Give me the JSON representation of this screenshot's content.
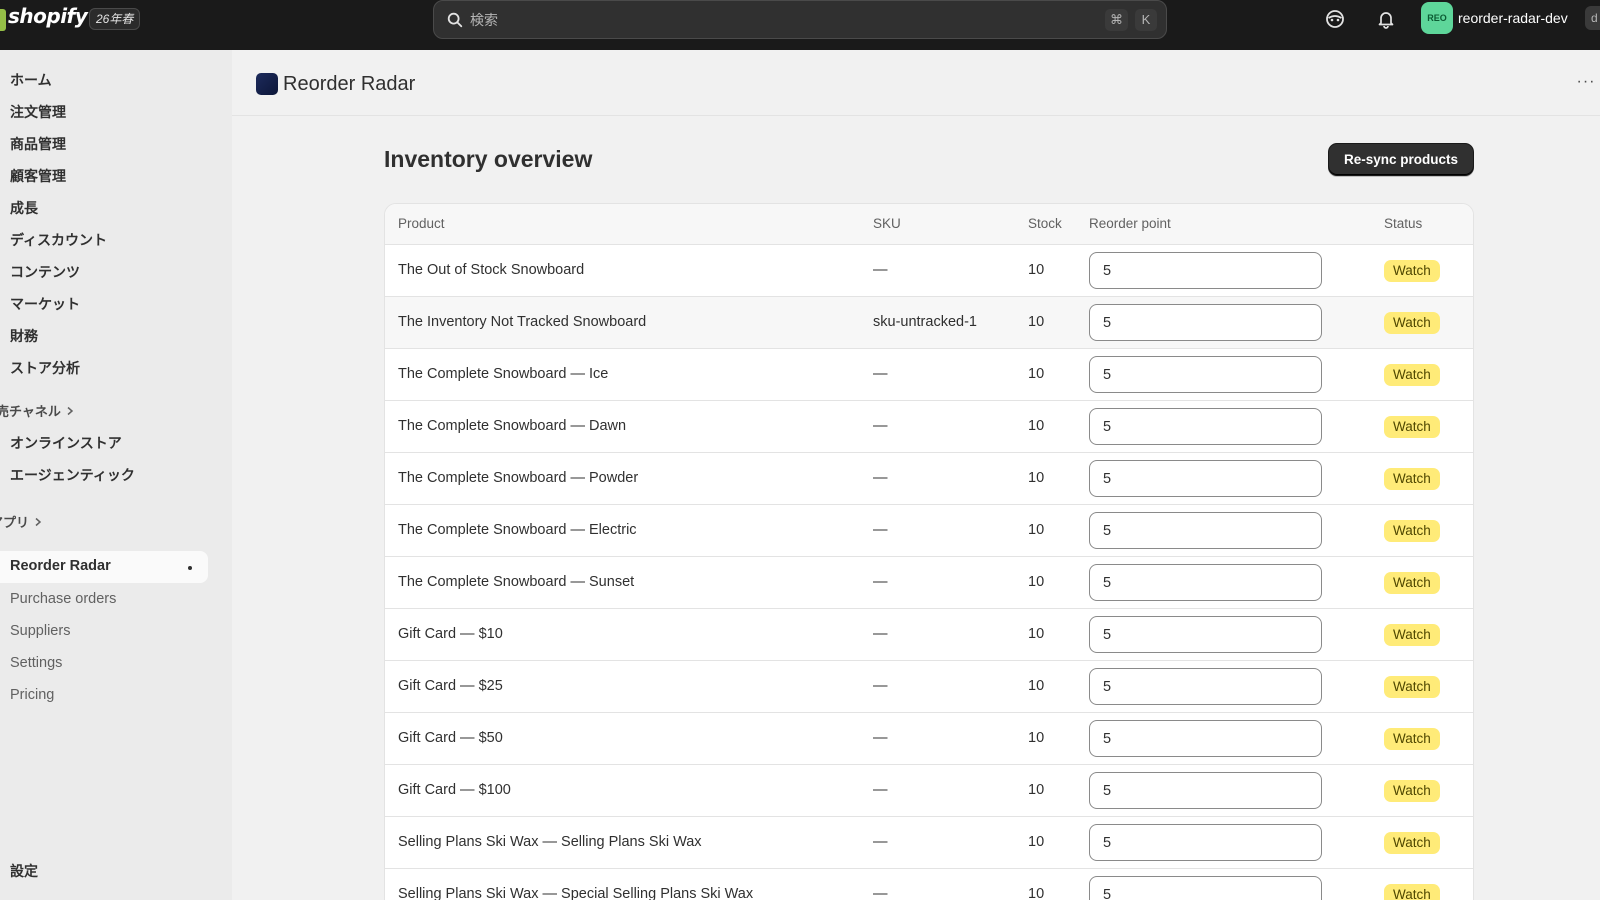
{
  "topbar": {
    "logo_text": "shopify",
    "edition_badge": "26年春",
    "search_placeholder": "検索",
    "shortcut_cmd": "⌘",
    "shortcut_key": "K",
    "store_avatar": "REO",
    "store_name": "reorder-radar-dev",
    "store_suffix": "d"
  },
  "sidebar": {
    "main_items": [
      "ホーム",
      "注文管理",
      "商品管理",
      "顧客管理",
      "成長",
      "ディスカウント",
      "コンテンツ",
      "マーケット",
      "財務",
      "ストア分析"
    ],
    "sales_channels_label": "売チャネル",
    "channel_items": [
      "オンラインストア",
      "エージェンティック"
    ],
    "apps_label": "アプリ",
    "active_app": "Reorder Radar",
    "app_sub_items": [
      "Purchase orders",
      "Suppliers",
      "Settings",
      "Pricing"
    ],
    "settings_label": "設定"
  },
  "app_header": {
    "title": "Reorder Radar",
    "more": "···"
  },
  "page": {
    "title": "Inventory overview",
    "resync_label": "Re-sync products"
  },
  "table": {
    "headers": {
      "product": "Product",
      "sku": "SKU",
      "stock": "Stock",
      "reorder_point": "Reorder point",
      "status": "Status"
    },
    "rows": [
      {
        "product": "The Out of Stock Snowboard",
        "sku": "—",
        "stock": "10",
        "reorder_point": "5",
        "status": "Watch"
      },
      {
        "product": "The Inventory Not Tracked Snowboard",
        "sku": "sku-untracked-1",
        "stock": "10",
        "reorder_point": "5",
        "status": "Watch"
      },
      {
        "product": "The Complete Snowboard — Ice",
        "sku": "—",
        "stock": "10",
        "reorder_point": "5",
        "status": "Watch"
      },
      {
        "product": "The Complete Snowboard — Dawn",
        "sku": "—",
        "stock": "10",
        "reorder_point": "5",
        "status": "Watch"
      },
      {
        "product": "The Complete Snowboard — Powder",
        "sku": "—",
        "stock": "10",
        "reorder_point": "5",
        "status": "Watch"
      },
      {
        "product": "The Complete Snowboard — Electric",
        "sku": "—",
        "stock": "10",
        "reorder_point": "5",
        "status": "Watch"
      },
      {
        "product": "The Complete Snowboard — Sunset",
        "sku": "—",
        "stock": "10",
        "reorder_point": "5",
        "status": "Watch"
      },
      {
        "product": "Gift Card — $10",
        "sku": "—",
        "stock": "10",
        "reorder_point": "5",
        "status": "Watch"
      },
      {
        "product": "Gift Card — $25",
        "sku": "—",
        "stock": "10",
        "reorder_point": "5",
        "status": "Watch"
      },
      {
        "product": "Gift Card — $50",
        "sku": "—",
        "stock": "10",
        "reorder_point": "5",
        "status": "Watch"
      },
      {
        "product": "Gift Card — $100",
        "sku": "—",
        "stock": "10",
        "reorder_point": "5",
        "status": "Watch"
      },
      {
        "product": "Selling Plans Ski Wax — Selling Plans Ski Wax",
        "sku": "—",
        "stock": "10",
        "reorder_point": "5",
        "status": "Watch"
      },
      {
        "product": "Selling Plans Ski Wax — Special Selling Plans Ski Wax",
        "sku": "—",
        "stock": "10",
        "reorder_point": "5",
        "status": "Watch"
      }
    ]
  },
  "colors": {
    "topbar_bg": "#1a1a1a",
    "sidebar_bg": "#ebebeb",
    "primary_button": "#303030",
    "watch_badge_bg": "#ffeb78",
    "store_avatar_bg": "#5ed69a"
  },
  "icons": {
    "search": "search-icon",
    "support": "support-icon",
    "notifications": "bell-icon",
    "chevron": "chevron-right-icon"
  }
}
